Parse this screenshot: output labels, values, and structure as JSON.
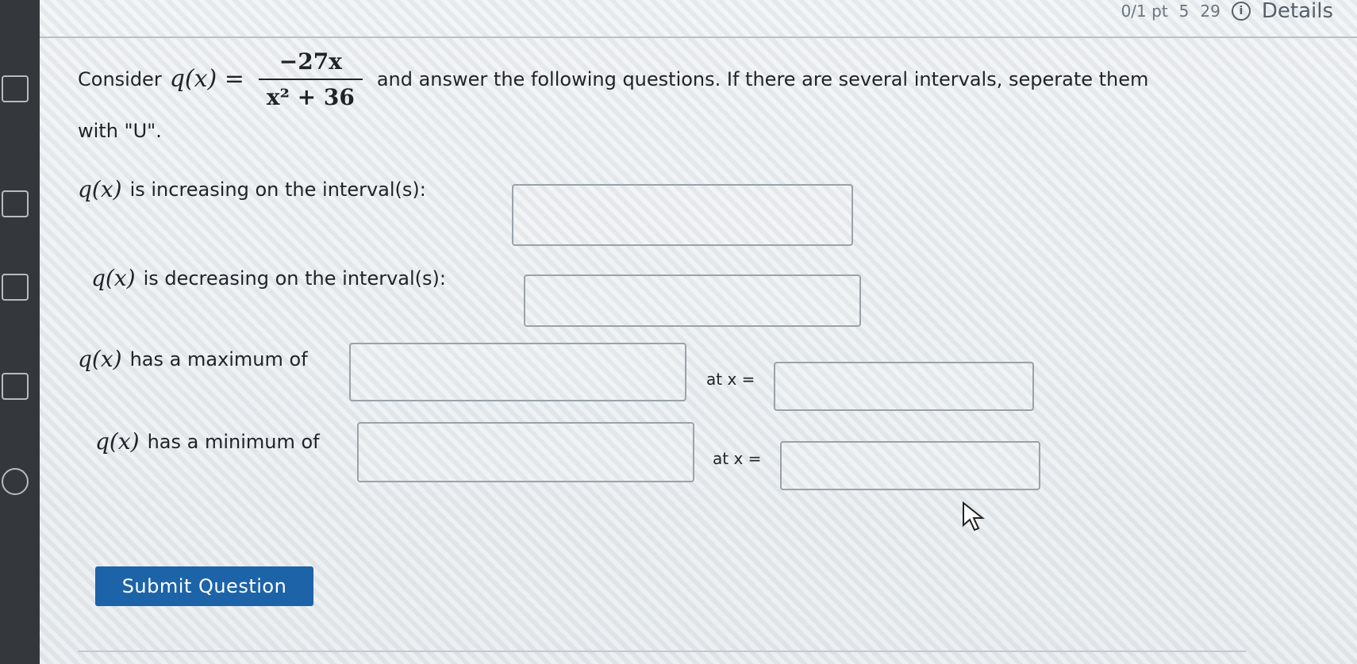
{
  "header": {
    "points": "0/1 pt",
    "retries": "5",
    "submissions": "29",
    "details_label": "Details"
  },
  "question": {
    "intro": "Consider",
    "function_lhs": "q(x) =",
    "numerator": "−27x",
    "denominator": "x² + 36",
    "instruction_part1": "and answer the following questions. If there are several intervals, seperate them",
    "instruction_part2": "with \"U\"."
  },
  "rows": {
    "fn_label": "q(x)",
    "increasing_label": "is increasing on the interval(s):",
    "decreasing_label": "is decreasing on the interval(s):",
    "maximum_label": "has a maximum of",
    "minimum_label": "has a minimum of",
    "at_x_label": "at x ="
  },
  "inputs": {
    "increasing_value": "",
    "decreasing_value": "",
    "max_value": "",
    "max_x_value": "",
    "min_value": "",
    "min_x_value": ""
  },
  "actions": {
    "submit_label": "Submit Question"
  },
  "colors": {
    "submit_bg": "#1d63a8"
  }
}
